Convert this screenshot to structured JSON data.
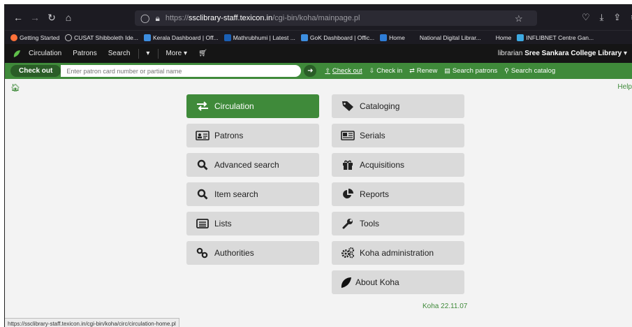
{
  "browser": {
    "url_prefix": "https://",
    "url_host": "ssclibrary-staff.texicon.in",
    "url_path": "/cgi-bin/koha/mainpage.pl",
    "status_url": "https://ssclibrary-staff.texicon.in/cgi-bin/koha/circ/circulation-home.pl"
  },
  "bookmarks": [
    {
      "label": "Getting Started",
      "color": "#ff7139"
    },
    {
      "label": "CUSAT Shibboleth Ide...",
      "color": "#6a6a6a"
    },
    {
      "label": "Kerala Dashboard | Off...",
      "color": "#3d8ee0"
    },
    {
      "label": "Mathrubhumi | Latest ...",
      "color": "#1a5fb4"
    },
    {
      "label": "GoK Dashboard | Offic...",
      "color": "#3d8ee0"
    },
    {
      "label": "Home",
      "color": "#2e7dd7"
    },
    {
      "label": "National Digital Librar...",
      "color": "#1c1b22"
    },
    {
      "label": "Home",
      "color": "#1c1b22"
    },
    {
      "label": "INFLIBNET Centre Gan...",
      "color": "#3da9e0"
    }
  ],
  "koha_nav": {
    "items": [
      "Circulation",
      "Patrons",
      "Search"
    ],
    "more": "More",
    "user_prefix": "librarian",
    "library": "Sree Sankara College Library"
  },
  "searchbar": {
    "tab": "Check out",
    "placeholder": "Enter patron card number or partial name",
    "links": [
      "Check out",
      "Check in",
      "Renew",
      "Search patrons",
      "Search catalog"
    ]
  },
  "help": "Help",
  "tiles": {
    "circulation": "Circulation",
    "patrons": "Patrons",
    "advanced_search": "Advanced search",
    "item_search": "Item search",
    "lists": "Lists",
    "authorities": "Authorities",
    "cataloging": "Cataloging",
    "serials": "Serials",
    "acquisitions": "Acquisitions",
    "reports": "Reports",
    "tools": "Tools",
    "koha_administration": "Koha administration",
    "about_koha": "About Koha"
  },
  "version": "Koha 22.11.07",
  "colors": {
    "koha_green": "#3f8a3a",
    "tile_grey": "#dadada",
    "nav_dark": "#151515"
  }
}
